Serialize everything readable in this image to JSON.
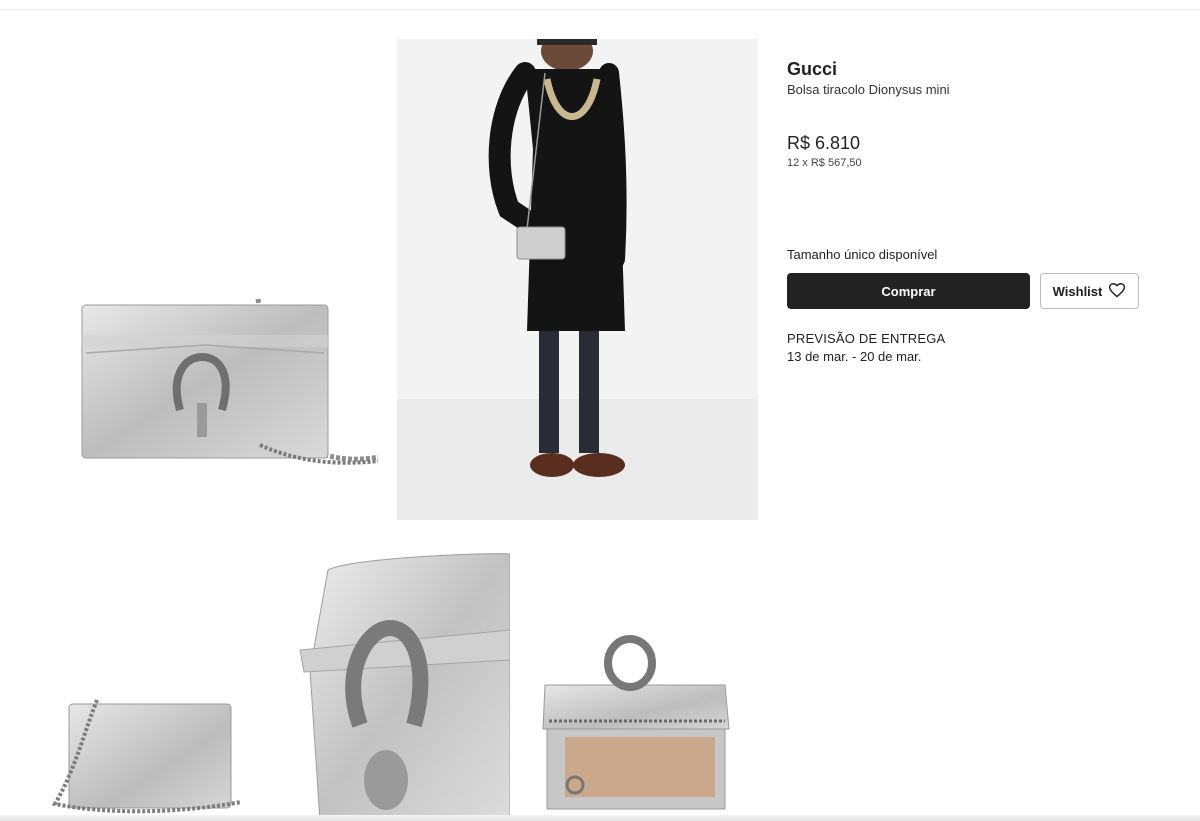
{
  "product": {
    "brand": "Gucci",
    "name": "Bolsa tiracolo Dionysus mini",
    "price": "R$ 6.810",
    "installments": "12 x R$ 567,50",
    "size_info": "Tamanho único disponível"
  },
  "actions": {
    "buy_label": "Comprar",
    "wishlist_label": "Wishlist",
    "wishlist_icon": "heart-icon"
  },
  "delivery": {
    "title": "PREVISÃO DE ENTREGA",
    "dates": "13 de mar. - 20 de mar."
  },
  "gallery": {
    "images": [
      "bag-front-view",
      "model-wearing-bag",
      "bag-side-view",
      "bag-clasp-closeup",
      "bag-open-interior"
    ]
  },
  "colors": {
    "button_dark": "#222222",
    "silver": "#c8c8c8",
    "background": "#ffffff"
  }
}
